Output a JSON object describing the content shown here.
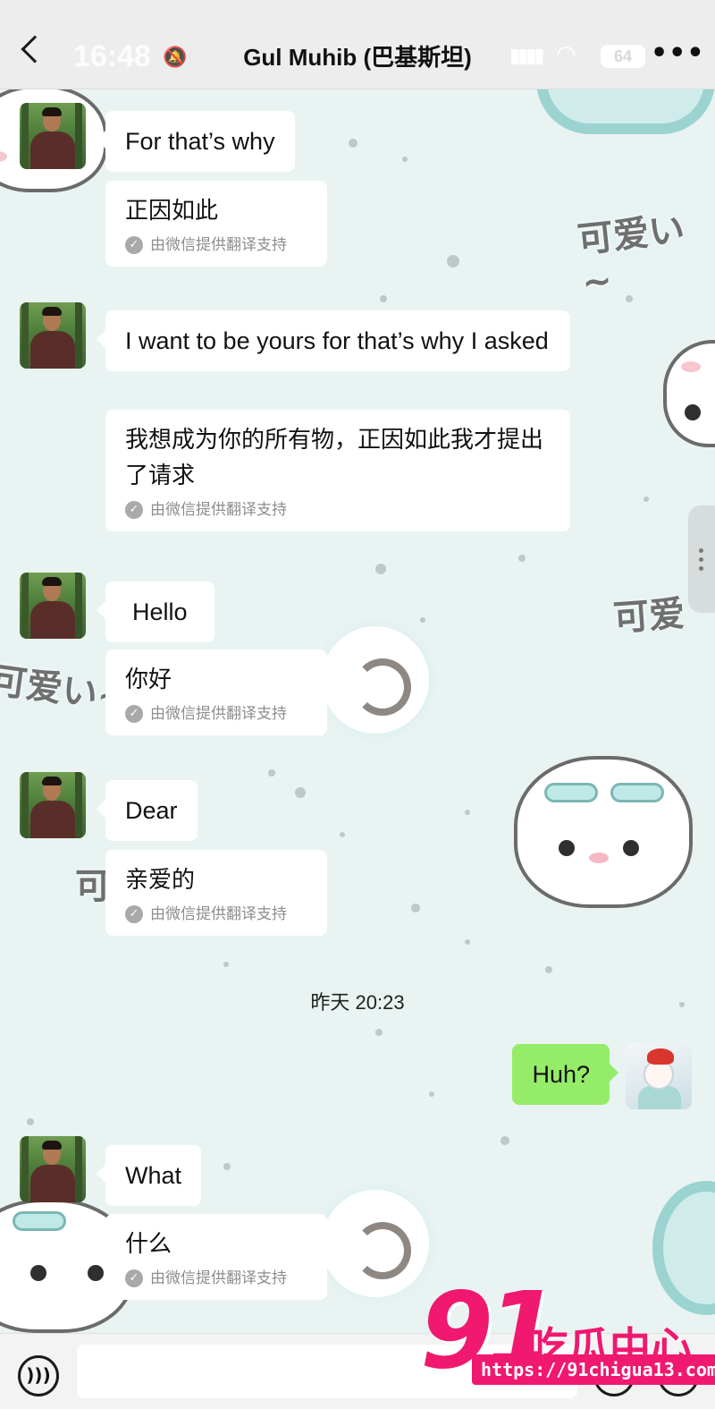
{
  "header": {
    "back_icon": "chevron-left-icon",
    "status_time": "16:48",
    "battery": "64",
    "title": "Gul Muhib (巴基斯坦)",
    "more_icon": "ellipsis-icon"
  },
  "messages": [
    {
      "from": "contact",
      "text": "For that’s why",
      "translation": "正因如此"
    },
    {
      "from": "contact",
      "text": "I want to be yours for that’s why I asked",
      "translation": "我想成为你的所有物，正因如此我才提出了请求"
    },
    {
      "from": "contact",
      "text": "Hello",
      "translation": "你好"
    },
    {
      "from": "contact",
      "text": "Dear",
      "translation": "亲爱的"
    },
    {
      "from": "system",
      "text": "昨天 20:23"
    },
    {
      "from": "me",
      "text": "Huh?"
    },
    {
      "from": "contact",
      "text": "What",
      "translation": "什么"
    }
  ],
  "translation_note": "由微信提供翻译支持",
  "background_stickers": [
    "可爱い~",
    "可爱",
    "可爱い~",
    "可"
  ],
  "watermark": {
    "number": "91",
    "text": "吃瓜中心",
    "url": "https://91chigua13.com"
  },
  "colors": {
    "my_bubble": "#95ec69",
    "their_bubble": "#ffffff",
    "watermark": "#f0186f"
  }
}
